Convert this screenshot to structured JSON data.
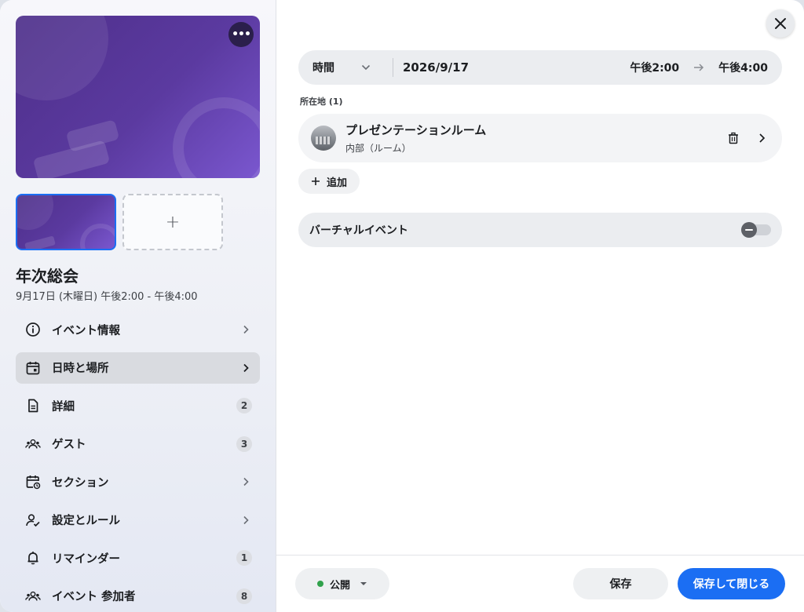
{
  "cover": {
    "more_icon": "ellipsis-icon",
    "add_icon": "plus-icon"
  },
  "event": {
    "title": "年次総会",
    "subtitle": "9月17日 (木曜日) 午後2:00 - 午後4:00"
  },
  "nav": {
    "items": [
      {
        "label": "イベント情報",
        "icon": "info-icon",
        "trail": "chevron",
        "badge": ""
      },
      {
        "label": "日時と場所",
        "icon": "calendar-icon",
        "trail": "chevron",
        "badge": "",
        "active": true
      },
      {
        "label": "詳細",
        "icon": "document-icon",
        "trail": "badge",
        "badge": "2"
      },
      {
        "label": "ゲスト",
        "icon": "people-icon",
        "trail": "badge",
        "badge": "3"
      },
      {
        "label": "セクション",
        "icon": "calendar-clock-icon",
        "trail": "chevron",
        "badge": ""
      },
      {
        "label": "設定とルール",
        "icon": "user-check-icon",
        "trail": "chevron",
        "badge": ""
      },
      {
        "label": "リマインダー",
        "icon": "bell-icon",
        "trail": "badge",
        "badge": "1"
      },
      {
        "label": "イベント 参加者",
        "icon": "people-icon",
        "trail": "badge",
        "badge": "8"
      }
    ]
  },
  "datetime": {
    "mode_label": "時間",
    "date": "2026/9/17",
    "start": "午後2:00",
    "end": "午後4:00"
  },
  "location": {
    "header": "所在地 (1)",
    "name": "プレゼンテーションルーム",
    "type": "内部（ルーム）"
  },
  "add_label": "追加",
  "virtual": {
    "label": "バーチャルイベント",
    "enabled": false
  },
  "footer": {
    "privacy_label": "公開",
    "privacy_color": "#31a24c",
    "save_label": "保存",
    "save_close_label": "保存して閉じる"
  },
  "colors": {
    "accent": "#1b6ef3"
  }
}
